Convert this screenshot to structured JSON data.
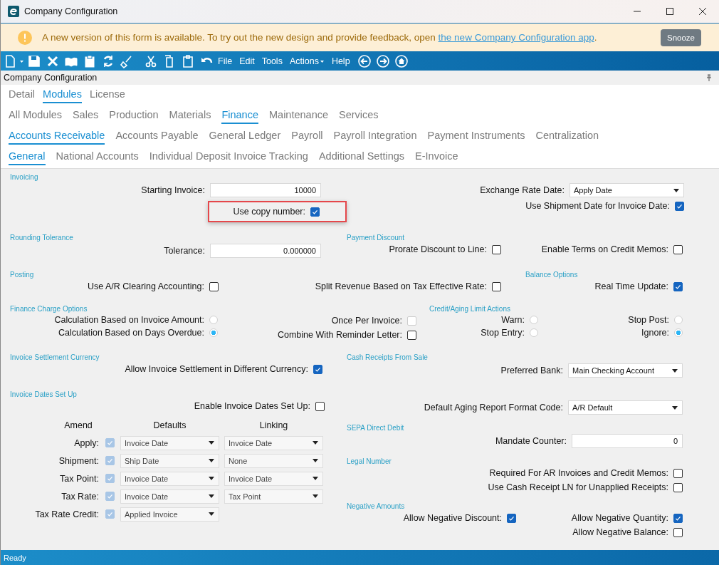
{
  "window": {
    "title": "Company Configuration"
  },
  "banner": {
    "message": "A new version of this form is available. To try out the new design and provide feedback, open ",
    "link": "the new Company Configuration app",
    "after_link": ".",
    "button": "Snooze"
  },
  "menus": [
    {
      "label": "File",
      "kind": "menu"
    },
    {
      "label": "Edit",
      "kind": "menu"
    },
    {
      "label": "Tools",
      "kind": "menu"
    },
    {
      "label": "Actions",
      "kind": "dropdown"
    },
    {
      "label": "Help",
      "kind": "menu"
    }
  ],
  "panel": {
    "title": "Company Configuration"
  },
  "tab_rows": [
    [
      {
        "label": "Detail",
        "selected": false
      },
      {
        "label": "Modules",
        "selected": true
      },
      {
        "label": "License",
        "selected": false
      }
    ],
    [
      {
        "label": "All Modules",
        "selected": false
      },
      {
        "label": "Sales",
        "selected": false
      },
      {
        "label": "Production",
        "selected": false
      },
      {
        "label": "Materials",
        "selected": false
      },
      {
        "label": "Finance",
        "selected": true
      },
      {
        "label": "Maintenance",
        "selected": false
      },
      {
        "label": "Services",
        "selected": false
      }
    ],
    [
      {
        "label": "Accounts Receivable",
        "selected": true
      },
      {
        "label": "Accounts Payable",
        "selected": false
      },
      {
        "label": "General Ledger",
        "selected": false
      },
      {
        "label": "Payroll",
        "selected": false
      },
      {
        "label": "Payroll Integration",
        "selected": false
      },
      {
        "label": "Payment Instruments",
        "selected": false
      },
      {
        "label": "Centralization",
        "selected": false
      }
    ],
    [
      {
        "label": "General",
        "selected": true
      },
      {
        "label": "National Accounts",
        "selected": false
      },
      {
        "label": "Individual Deposit Invoice Tracking",
        "selected": false
      },
      {
        "label": "Additional Settings",
        "selected": false
      },
      {
        "label": "E-Invoice",
        "selected": false
      }
    ]
  ],
  "form": {
    "bands": [
      {
        "stacks": [
          {
            "sections": [
              {
                "heading": "Invoicing",
                "items": [
                  {
                    "kind": "text-field",
                    "label": "Starting Invoice:",
                    "value": "10000"
                  },
                  {
                    "kind": "checkbox",
                    "label": "Use copy number:",
                    "checked": true,
                    "disabled": false,
                    "highlighted": true
                  }
                ]
              }
            ]
          },
          {
            "sections": [
              {
                "items": [
                  {
                    "kind": "dropdown",
                    "label": "Exchange Rate Date:",
                    "value": "Apply Date"
                  },
                  {
                    "kind": "checkbox",
                    "label": "Use Shipment Date for Invoice Date:",
                    "checked": true,
                    "disabled": false
                  }
                ]
              }
            ]
          }
        ]
      },
      {
        "stacks": [
          {
            "sections": [
              {
                "heading": "Rounding Tolerance",
                "items": [
                  {
                    "kind": "text-field",
                    "label": "Tolerance:",
                    "value": "0.000000"
                  }
                ]
              }
            ]
          },
          {
            "sections": [
              {
                "heading": "Payment Discount",
                "items": [
                  {
                    "kind": "checkbox",
                    "label": "Prorate Discount to Line:",
                    "checked": false,
                    "disabled": false
                  }
                ]
              }
            ]
          },
          {
            "sections": [
              {
                "items": [
                  {
                    "kind": "checkbox",
                    "label": "Enable Terms on Credit Memos:",
                    "checked": false,
                    "disabled": false
                  }
                ]
              }
            ]
          }
        ]
      },
      {
        "stacks": [
          {
            "sections": [
              {
                "heading": "Posting",
                "items": [
                  {
                    "kind": "checkbox",
                    "label": "Use A/R Clearing Accounting:",
                    "checked": false,
                    "disabled": false
                  }
                ]
              }
            ]
          },
          {
            "sections": [
              {
                "items": [
                  {
                    "kind": "checkbox",
                    "label": "Split Revenue Based on Tax Effective Rate:",
                    "checked": false,
                    "disabled": false
                  }
                ]
              }
            ]
          },
          {
            "sections": [
              {
                "heading": "Balance Options",
                "items": [
                  {
                    "kind": "checkbox",
                    "label": "Real Time Update:",
                    "checked": true,
                    "disabled": false
                  }
                ]
              }
            ]
          }
        ]
      },
      {
        "stacks": [
          {
            "sections": [
              {
                "heading": "Finance Charge Options",
                "items": [
                  {
                    "kind": "radio",
                    "label": "Calculation Based on Invoice Amount:",
                    "selected": false
                  },
                  {
                    "kind": "radio",
                    "label": "Calculation Based on Days Overdue:",
                    "selected": true
                  }
                ]
              }
            ]
          },
          {
            "sections": [
              {
                "items": [
                  {
                    "kind": "checkbox",
                    "label": "Once Per Invoice:",
                    "checked": false,
                    "disabled": true
                  },
                  {
                    "kind": "checkbox",
                    "label": "Combine With Reminder Letter:",
                    "checked": false,
                    "disabled": false
                  }
                ]
              }
            ]
          },
          {
            "sections": [
              {
                "heading": "Credit/Aging Limit Actions",
                "items": [
                  {
                    "kind": "radio",
                    "label": "Warn:",
                    "selected": false
                  },
                  {
                    "kind": "radio",
                    "label": "Stop Entry:",
                    "selected": false
                  }
                ]
              }
            ]
          },
          {
            "sections": [
              {
                "items": [
                  {
                    "kind": "radio",
                    "label": "Stop Post:",
                    "selected": false
                  },
                  {
                    "kind": "radio",
                    "label": "Ignore:",
                    "selected": true
                  }
                ]
              }
            ]
          }
        ]
      },
      {
        "stacks": [
          {
            "sections": [
              {
                "heading": "Invoice Settlement Currency",
                "items": [
                  {
                    "kind": "checkbox",
                    "label": "Allow Invoice Settlement in Different Currency:",
                    "checked": true,
                    "disabled": false
                  }
                ]
              }
            ]
          },
          {
            "sections": [
              {
                "heading": "Cash Receipts From Sale",
                "items": [
                  {
                    "kind": "dropdown",
                    "label": "Preferred Bank:",
                    "value": "Main Checking Account"
                  }
                ]
              }
            ]
          }
        ]
      },
      {
        "stacks": [
          {
            "sections": [
              {
                "heading": "Invoice Dates Set Up",
                "items": [
                  {
                    "kind": "checkbox",
                    "label": "Enable Invoice Dates Set Up:",
                    "checked": false,
                    "disabled": false
                  }
                ],
                "table": {
                  "columns": [
                    "Amend",
                    "Defaults",
                    "Linking"
                  ],
                  "rows": [
                    {
                      "label": "Apply:",
                      "amend": true,
                      "default": "Invoice Date",
                      "linking": "Invoice Date"
                    },
                    {
                      "label": "Shipment:",
                      "amend": true,
                      "default": "Ship Date",
                      "linking": "None"
                    },
                    {
                      "label": "Tax Point:",
                      "amend": true,
                      "default": "Invoice Date",
                      "linking": "Invoice Date"
                    },
                    {
                      "label": "Tax Rate:",
                      "amend": true,
                      "default": "Invoice Date",
                      "linking": "Tax Point"
                    },
                    {
                      "label": "Tax Rate Credit:",
                      "amend": true,
                      "default": "Applied Invoice"
                    }
                  ]
                }
              }
            ]
          },
          {
            "sections": [
              {
                "items": [
                  {
                    "kind": "dropdown",
                    "label": "Default Aging Report Format Code:",
                    "value": "A/R Default"
                  }
                ]
              },
              {
                "heading": "SEPA Direct Debit",
                "items": [
                  {
                    "kind": "text-field",
                    "label": "Mandate Counter:",
                    "value": "0"
                  }
                ]
              },
              {
                "heading": "Legal Number",
                "items": [
                  {
                    "kind": "checkbox",
                    "label": "Required For AR Invoices and Credit Memos:",
                    "checked": false,
                    "disabled": false
                  },
                  {
                    "kind": "checkbox",
                    "label": "Use Cash Receipt LN for Unapplied Receipts:",
                    "checked": false,
                    "disabled": false
                  }
                ]
              },
              {
                "heading": "Negative Amounts",
                "columns": [
                  [
                    {
                      "kind": "checkbox",
                      "label": "Allow Negative Discount:",
                      "checked": true,
                      "disabled": false
                    }
                  ],
                  [
                    {
                      "kind": "checkbox",
                      "label": "Allow Negative Quantity:",
                      "checked": true,
                      "disabled": false
                    },
                    {
                      "kind": "checkbox",
                      "label": "Allow Negative Balance:",
                      "checked": false,
                      "disabled": false
                    }
                  ]
                ]
              }
            ]
          }
        ]
      }
    ]
  },
  "status_bar": {
    "text": "Ready"
  }
}
